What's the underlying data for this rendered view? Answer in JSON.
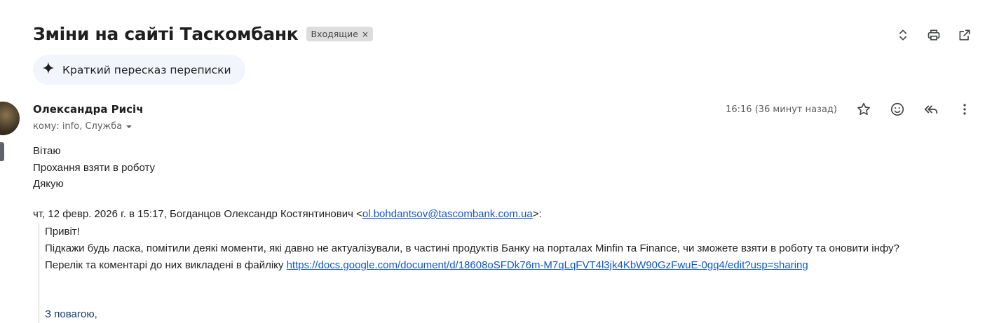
{
  "thread": {
    "subject": "Зміни на сайті Таскомбанк",
    "label": "Входящие",
    "label_remove": "×"
  },
  "toolbar": {
    "icons": [
      "expand-collapse-icon",
      "print-icon",
      "open-in-new-window-icon"
    ]
  },
  "summary": {
    "label": "Краткий пересказ переписки",
    "icon": "sparkle-icon"
  },
  "message": {
    "sender": "Олександра Рисіч",
    "recipients": "кому: info, Служба",
    "time": "16:16 (36 минут назад)",
    "actions": [
      "star-icon",
      "emoji-reaction-icon",
      "reply-all-icon",
      "more-options-icon"
    ],
    "body": [
      "Вітаю",
      "Прохання взяти в роботу",
      "Дякую"
    ]
  },
  "quoted": {
    "header_prefix": "чт, 12 февр. 2026 г. в 15:17, Богданцов Олександр Костянтинович <",
    "email": "ol.bohdantsov@tascombank.com.ua",
    "header_suffix": ">:",
    "greeting": "Привіт!",
    "line1": "Підкажи будь ласка, помітили деякі моменти, які давно не актуалізували, в частині продуктів Банку на порталах Minfin та Finance, чи зможете взяти в роботу та оновити інфу?",
    "line2_prefix": "Перелік та коментарі до них викладені в файліку ",
    "link": "https://docs.google.com/document/d/18608oSFDk76m-M7qLqFVT4l3jk4KbW90GzFwuE-0gq4/edit?usp=sharing",
    "regards": "З повагою,"
  },
  "colors": {
    "link": "#1155cc",
    "summary_bg": "#f2f6fc",
    "label_bg": "#dddddd"
  }
}
